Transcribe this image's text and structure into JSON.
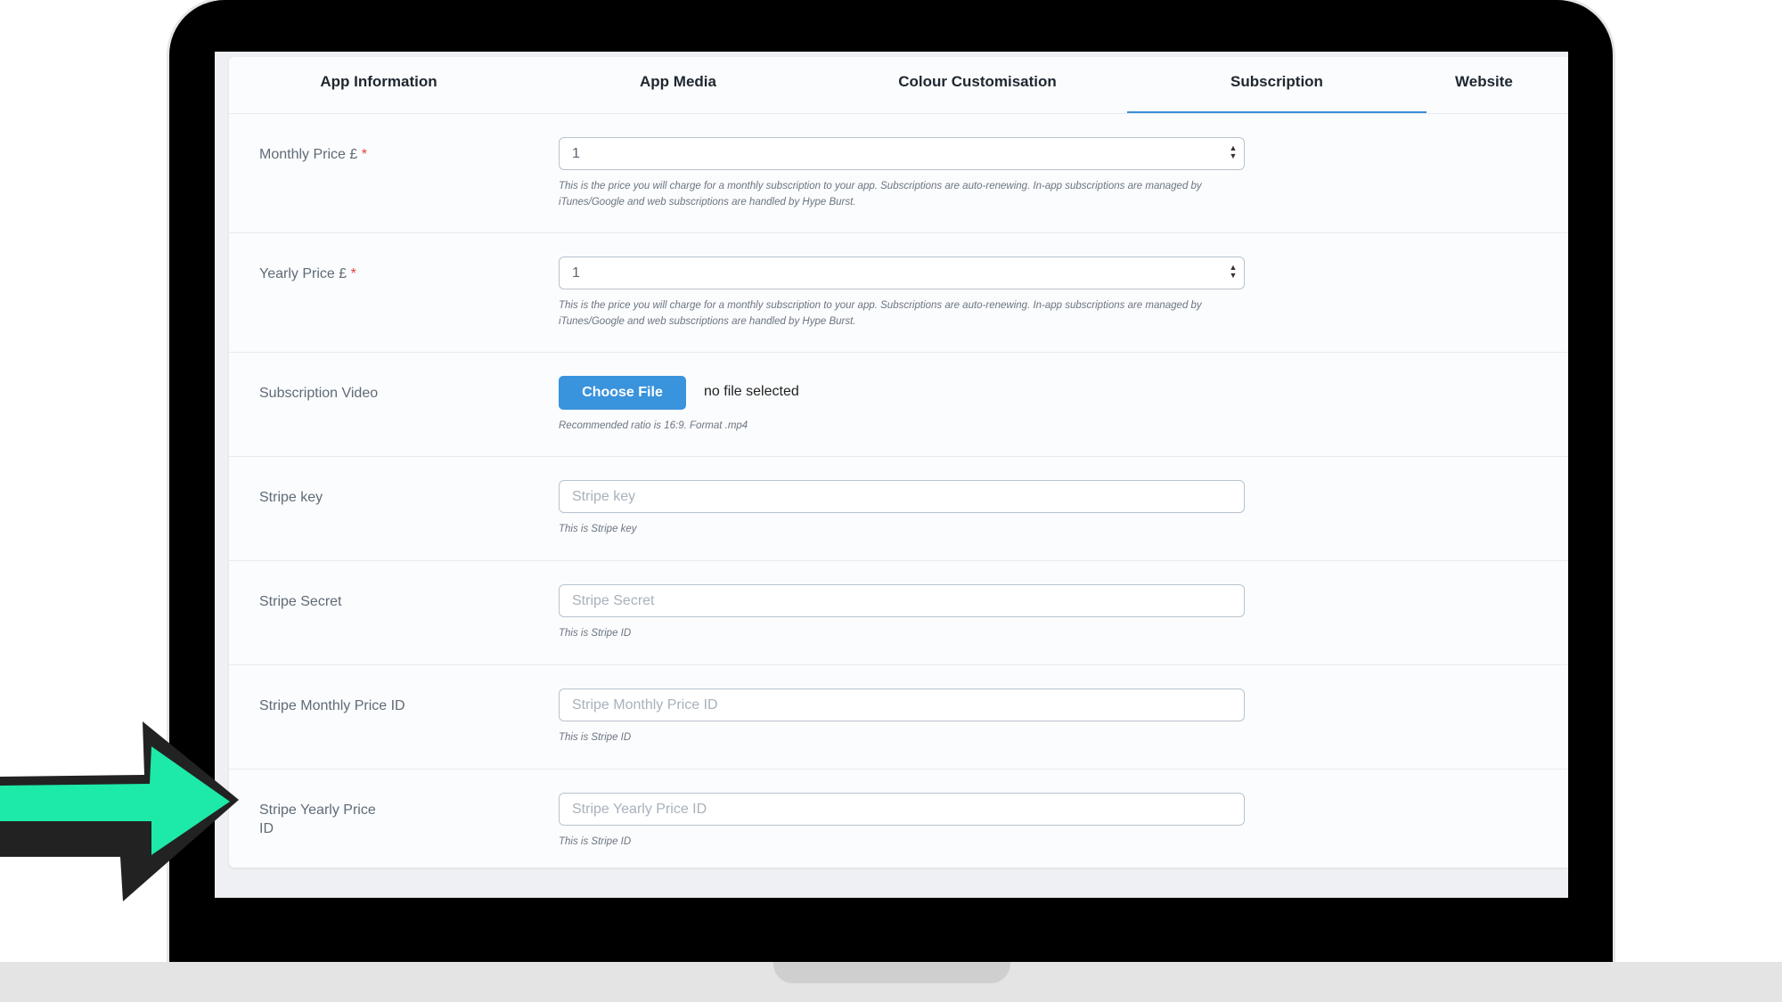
{
  "tabs": [
    {
      "label": "App Information"
    },
    {
      "label": "App Media"
    },
    {
      "label": "Colour Customisation"
    },
    {
      "label": "Subscription",
      "active": true
    },
    {
      "label": "Website"
    }
  ],
  "fields": {
    "monthly_price": {
      "label": "Monthly Price £",
      "required_mark": "*",
      "value": "1",
      "help": "This is the price you will charge for a monthly subscription to your app. Subscriptions are auto-renewing. In-app subscriptions are managed by iTunes/Google and web subscriptions are handled by Hype Burst."
    },
    "yearly_price": {
      "label": "Yearly Price £",
      "required_mark": "*",
      "value": "1",
      "help": "This is the price you will charge for a monthly subscription to your app. Subscriptions are auto-renewing. In-app subscriptions are managed by iTunes/Google and web subscriptions are handled by Hype Burst."
    },
    "subscription_video": {
      "label": "Subscription Video",
      "button_label": "Choose File",
      "status": "no file selected",
      "help": "Recommended ratio is 16:9. Format .mp4"
    },
    "stripe_key": {
      "label": "Stripe key",
      "placeholder": "Stripe key",
      "help": "This is Stripe key"
    },
    "stripe_secret": {
      "label": "Stripe Secret",
      "placeholder": "Stripe Secret",
      "help": "This is Stripe ID"
    },
    "stripe_monthly_price_id": {
      "label": "Stripe Monthly Price ID",
      "placeholder": "Stripe Monthly Price ID",
      "help": "This is Stripe ID"
    },
    "stripe_yearly_price_id": {
      "label_line1": "Stripe Yearly Price",
      "label_line2": "ID",
      "placeholder": "Stripe Yearly Price ID",
      "help": "This is Stripe ID"
    }
  },
  "colors": {
    "accent": "#3a93dd",
    "arrow_fill": "#1de9a8",
    "arrow_outline": "#222222",
    "required": "#e2403a"
  },
  "icons": {
    "spinner": "number-spinner-icon",
    "pointer": "pointer-arrow-icon"
  }
}
